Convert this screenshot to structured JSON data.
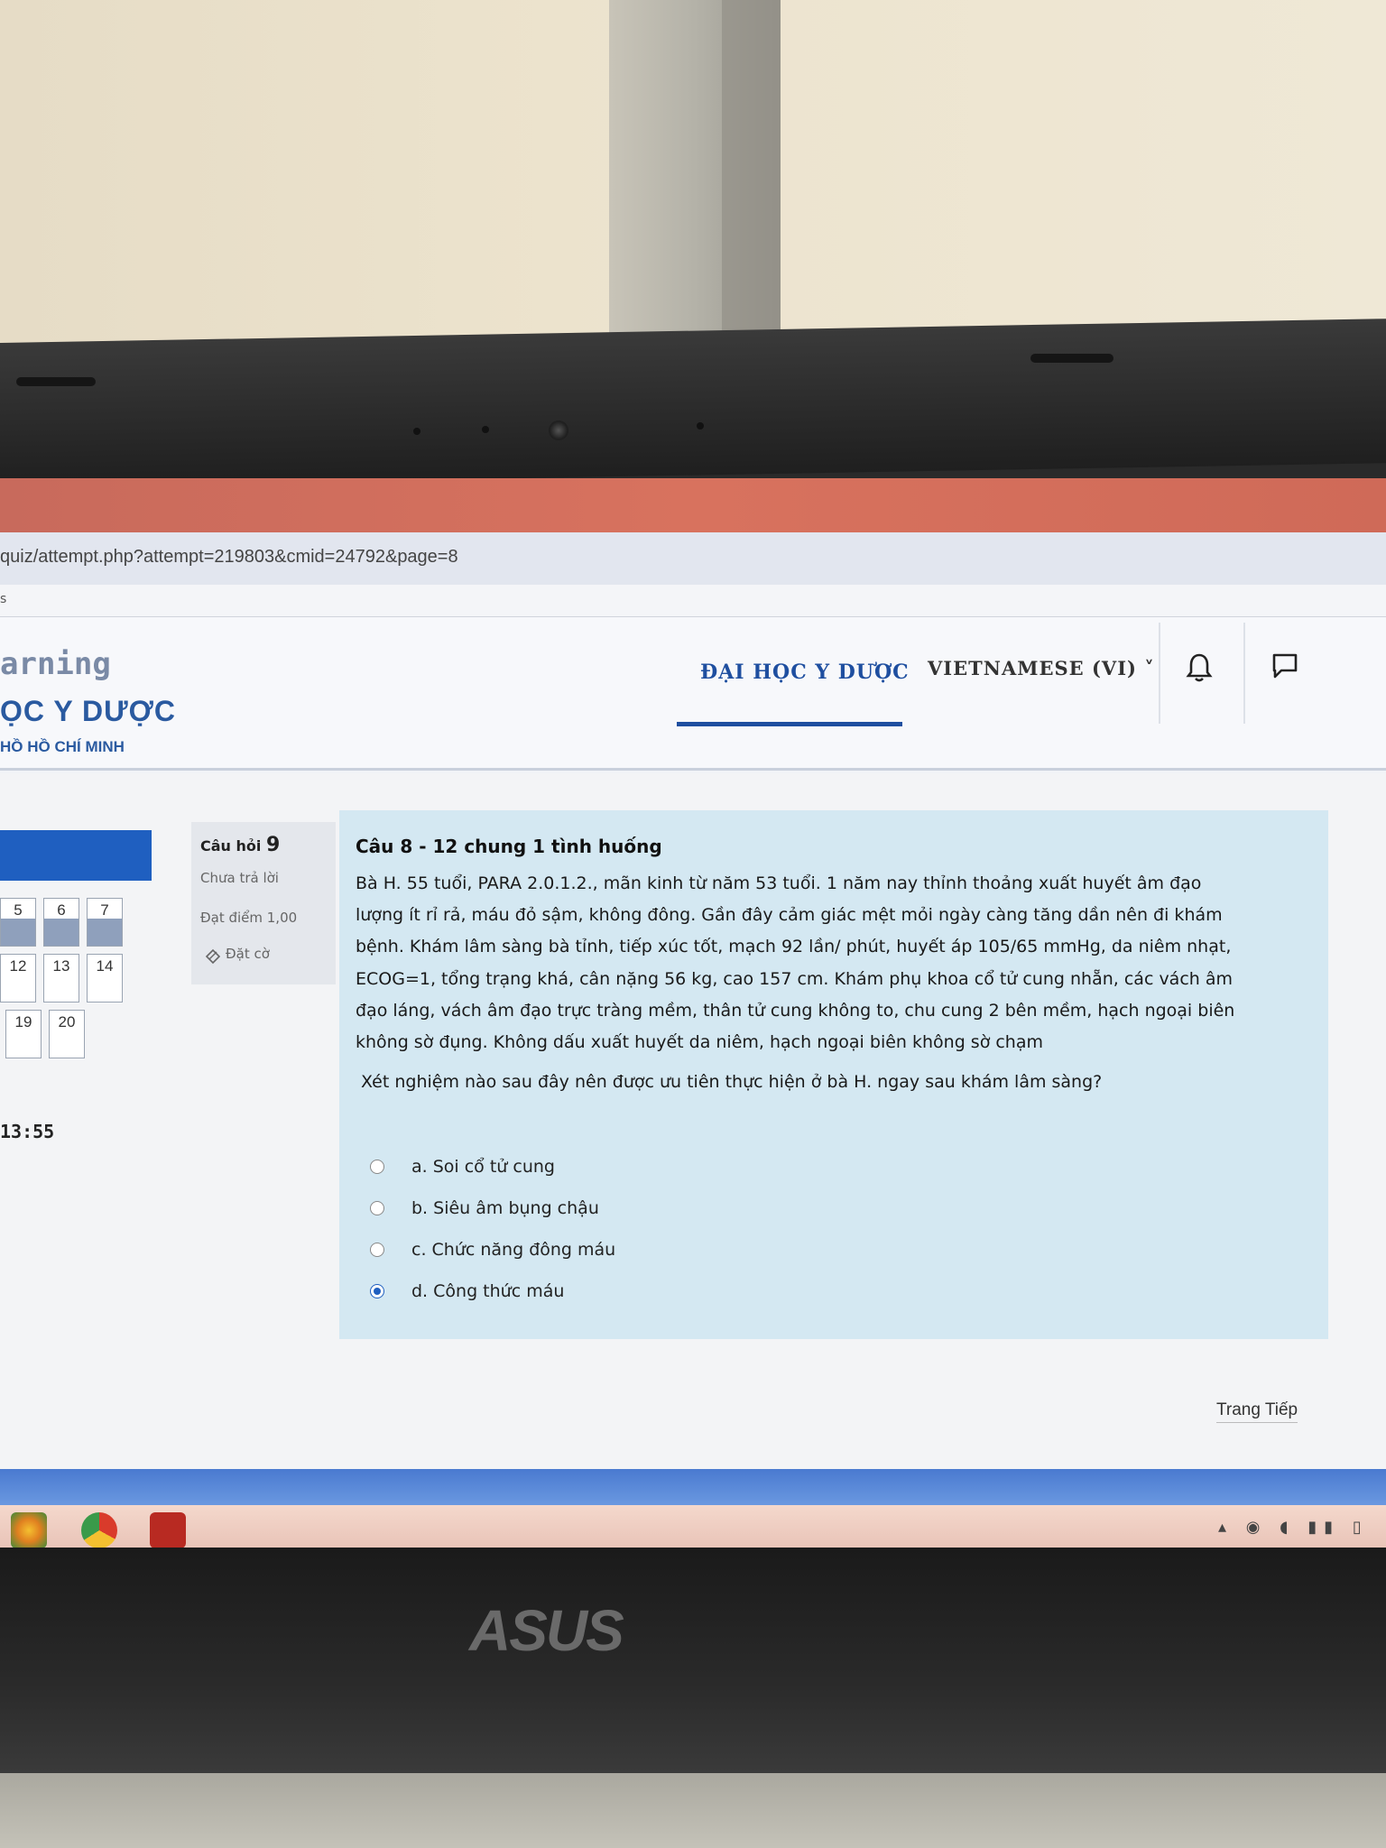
{
  "browser": {
    "url": "quiz/attempt.php?attempt=219803&cmid=24792&page=8",
    "bookmark_text": "s"
  },
  "site": {
    "logo_line1": "arning",
    "logo_line2": "ỌC Y DƯỢC",
    "logo_line3": "HỒ HỒ CHÍ MINH",
    "nav_university": "ĐẠI HỌC Y DƯỢC",
    "nav_language": "VIETNAMESE (VI) ˅"
  },
  "quiz_nav": {
    "buttons": [
      {
        "label": "5",
        "answered": true
      },
      {
        "label": "6",
        "answered": true
      },
      {
        "label": "7",
        "answered": true
      },
      {
        "label": "12",
        "answered": false
      },
      {
        "label": "13",
        "answered": false
      },
      {
        "label": "14",
        "answered": false
      },
      {
        "label": "19",
        "answered": false
      },
      {
        "label": "20",
        "answered": false
      }
    ],
    "timer": "13:55"
  },
  "question_info": {
    "label": "Câu hỏi",
    "number": "9",
    "status": "Chưa trả lời",
    "grade": "Đạt điểm 1,00",
    "flag": "Đặt cờ"
  },
  "question": {
    "heading": "Câu 8 - 12 chung 1 tình huống",
    "lines": [
      "Bà H. 55 tuổi, PARA 2.0.1.2., mãn kinh từ năm 53 tuổi. 1 năm nay thỉnh thoảng xuất huyết âm đạo",
      "lượng ít rỉ rả, máu đỏ sậm, không đông. Gần đây cảm giác mệt mỏi ngày càng tăng dần nên đi khám",
      "bệnh. Khám lâm sàng bà tỉnh, tiếp xúc tốt, mạch 92 lần/ phút, huyết áp 105/65 mmHg, da niêm nhạt,",
      "ECOG=1, tổng trạng khá, cân nặng 56 kg, cao 157 cm. Khám phụ khoa cổ tử cung nhẵn, các vách âm",
      "đạo láng, vách âm đạo trực tràng mềm, thân tử cung không to, chu cung 2 bên mềm, hạch ngoại biên",
      "không sờ đụng. Không dấu xuất huyết da niêm, hạch ngoại biên không sờ chạm"
    ],
    "ask": "Xét nghiệm nào sau đây nên được ưu tiên thực hiện ở bà H. ngay sau khám lâm sàng?",
    "options": [
      {
        "label": "a. Soi cổ tử cung",
        "checked": false
      },
      {
        "label": "b. Siêu âm bụng chậu",
        "checked": false
      },
      {
        "label": "c. Chức năng đông máu",
        "checked": false
      },
      {
        "label": "d. Công thức máu",
        "checked": true
      }
    ],
    "next_label": "Trang Tiếp"
  },
  "laptop": {
    "brand": "ASUS"
  }
}
